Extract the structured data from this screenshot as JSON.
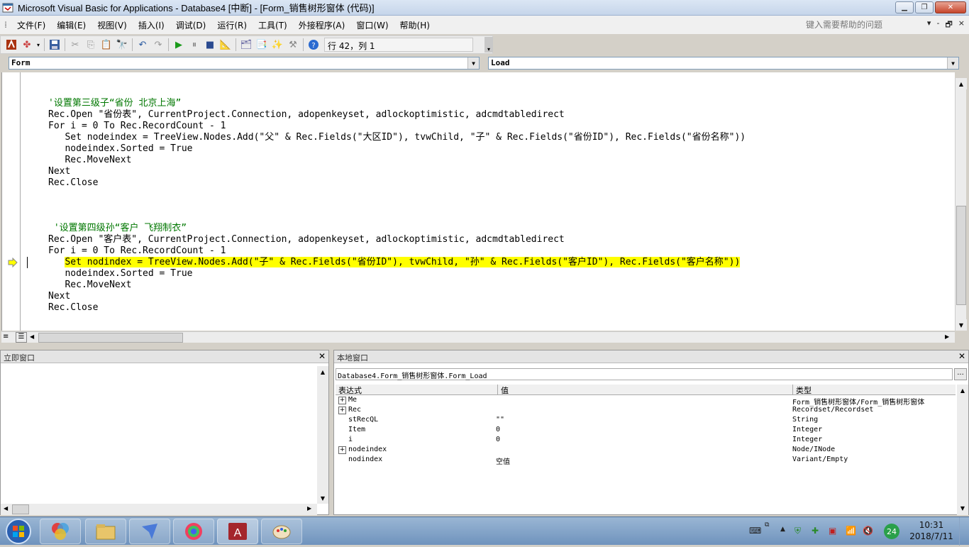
{
  "window": {
    "title": "Microsoft Visual Basic for Applications - Database4 [中断] - [Form_销售树形窗体 (代码)]",
    "min_label": "▁",
    "max_label": "❐",
    "close_label": "✕"
  },
  "menu": {
    "items": [
      "文件(F)",
      "编辑(E)",
      "视图(V)",
      "插入(I)",
      "调试(D)",
      "运行(R)",
      "工具(T)",
      "外接程序(A)",
      "窗口(W)",
      "帮助(H)"
    ],
    "help_placeholder": "键入需要帮助的问题",
    "mdi_min": "-",
    "mdi_restore": "🗗",
    "mdi_close": "×"
  },
  "toolbar": {
    "position": "行 42，列 1"
  },
  "combos": {
    "object": "Form",
    "procedure": "Load"
  },
  "code": {
    "lines": [
      "'设置第三级子“省份 北京上海”",
      "Rec.Open \"省份表\", CurrentProject.Connection, adopenkeyset, adlockoptimistic, adcmdtabledirect",
      "For i = 0 To Rec.RecordCount - 1",
      "   Set nodeindex = TreeView.Nodes.Add(\"父\" & Rec.Fields(\"大区ID\"), tvwChild, \"子\" & Rec.Fields(\"省份ID\"), Rec.Fields(\"省份名称\"))",
      "   nodeindex.Sorted = True",
      "   Rec.MoveNext",
      "Next",
      "Rec.Close",
      " '设置第四级孙“客户 飞翔制衣”",
      "Rec.Open \"客户表\", CurrentProject.Connection, adopenkeyset, adlockoptimistic, adcmdtabledirect",
      "For i = 0 To Rec.RecordCount - 1",
      "   Set nodindex = TreeView.Nodes.Add(\"子\" & Rec.Fields(\"省份ID\"), tvwChild, \"孙\" & Rec.Fields(\"客户ID\"), Rec.Fields(\"客户名称\"))",
      "   nodeindex.Sorted = True",
      "   Rec.MoveNext",
      "Next",
      "Rec.Close"
    ]
  },
  "immediate": {
    "title": "立即窗口"
  },
  "locals": {
    "title": "本地窗口",
    "context": "Database4.Form_销售树形窗体.Form_Load",
    "ellipsis": "...",
    "headers": [
      "表达式",
      "值",
      "类型"
    ],
    "rows": [
      {
        "expander": "+",
        "name": "Me",
        "value": "",
        "type": "Form_销售树形窗体/Form_销售树形窗体"
      },
      {
        "expander": "+",
        "name": "Rec",
        "value": "",
        "type": "Recordset/Recordset"
      },
      {
        "expander": "",
        "name": "stRecQL",
        "value": "\"\"",
        "type": "String"
      },
      {
        "expander": "",
        "name": "Item",
        "value": "0",
        "type": "Integer"
      },
      {
        "expander": "",
        "name": "i",
        "value": "0",
        "type": "Integer"
      },
      {
        "expander": "+",
        "name": "nodeindex",
        "value": "",
        "type": "Node/INode"
      },
      {
        "expander": "",
        "name": "nodindex",
        "value": "空值",
        "type": "Variant/Empty"
      }
    ]
  },
  "taskbar": {
    "time": "10:31",
    "date": "2018/7/11",
    "badge": "24"
  },
  "colors": {
    "highlight": "#ffff00",
    "comment": "#007700",
    "keyword": "#00007b"
  }
}
